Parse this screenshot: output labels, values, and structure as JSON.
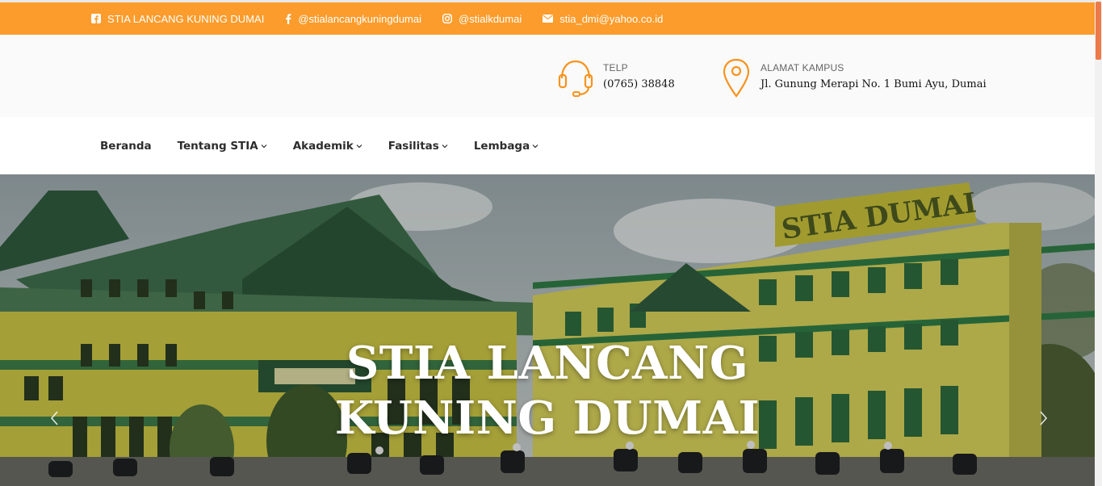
{
  "topbar": {
    "items": [
      {
        "icon": "facebook-square-icon",
        "text": "STIA LANCANG KUNING DUMAI"
      },
      {
        "icon": "facebook-icon",
        "text": "@stialancangkuningdumai"
      },
      {
        "icon": "instagram-icon",
        "text": "@stialkdumai"
      },
      {
        "icon": "envelope-icon",
        "text": "stia_dmi@yahoo.co.id"
      }
    ]
  },
  "header": {
    "telp": {
      "icon": "headset-icon",
      "label": "TELP",
      "value": "(0765) 38848"
    },
    "alamat": {
      "icon": "map-pin-icon",
      "label": "ALAMAT KAMPUS",
      "value": "Jl. Gunung Merapi No. 1 Bumi Ayu, Dumai"
    }
  },
  "nav": {
    "items": [
      {
        "label": "Beranda",
        "has_dropdown": false
      },
      {
        "label": "Tentang STIA",
        "has_dropdown": true
      },
      {
        "label": "Akademik",
        "has_dropdown": true
      },
      {
        "label": "Fasilitas",
        "has_dropdown": true
      },
      {
        "label": "Lembaga",
        "has_dropdown": true
      }
    ]
  },
  "hero": {
    "title": "STIA LANCANG KUNING DUMAI",
    "building_sign": "STIA DUMAI",
    "prev_icon": "chevron-left-icon",
    "next_icon": "chevron-right-icon"
  },
  "colors": {
    "topbar_bg": "#fc9c2c",
    "accent": "#f7931e",
    "nav_text": "#2d2d2d"
  }
}
